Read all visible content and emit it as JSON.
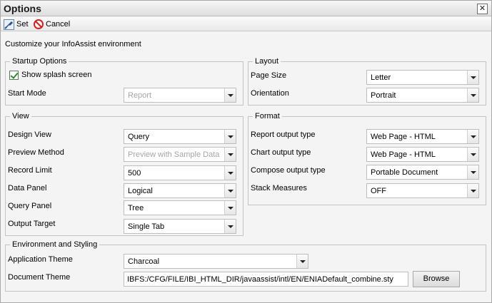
{
  "window": {
    "title": "Options"
  },
  "toolbar": {
    "set_label": "Set",
    "cancel_label": "Cancel"
  },
  "intro": "Customize your InfoAssist environment",
  "startup": {
    "title": "Startup Options",
    "splash_label": "Show splash screen",
    "splash_checked": true,
    "start_mode_label": "Start Mode",
    "start_mode_value": "Report"
  },
  "view": {
    "title": "View",
    "design_view_label": "Design View",
    "design_view_value": "Query",
    "preview_method_label": "Preview Method",
    "preview_method_value": "Preview with Sample Data",
    "record_limit_label": "Record Limit",
    "record_limit_value": "500",
    "data_panel_label": "Data Panel",
    "data_panel_value": "Logical",
    "query_panel_label": "Query Panel",
    "query_panel_value": "Tree",
    "output_target_label": "Output Target",
    "output_target_value": "Single Tab"
  },
  "layout": {
    "title": "Layout",
    "page_size_label": "Page Size",
    "page_size_value": "Letter",
    "orientation_label": "Orientation",
    "orientation_value": "Portrait"
  },
  "format": {
    "title": "Format",
    "report_output_label": "Report output type",
    "report_output_value": "Web Page - HTML",
    "chart_output_label": "Chart output type",
    "chart_output_value": "Web Page - HTML",
    "compose_output_label": "Compose output type",
    "compose_output_value": "Portable Document",
    "stack_measures_label": "Stack Measures",
    "stack_measures_value": "OFF"
  },
  "environment": {
    "title": "Environment and Styling",
    "app_theme_label": "Application Theme",
    "app_theme_value": "Charcoal",
    "doc_theme_label": "Document Theme",
    "doc_theme_value": "IBFS:/CFG/FILE/IBI_HTML_DIR/javaassist/intl/EN/ENIADefault_combine.sty",
    "browse_label": "Browse"
  }
}
